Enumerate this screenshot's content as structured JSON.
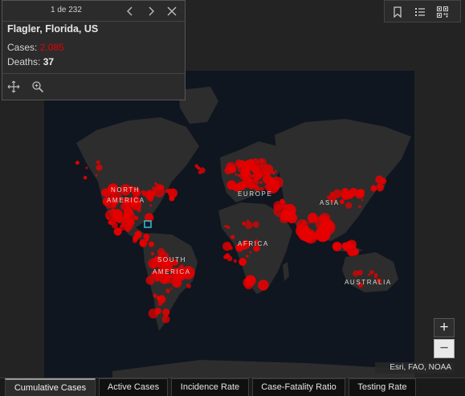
{
  "popup": {
    "counter": "1 de 232",
    "title": "Flagler, Florida, US",
    "cases_label": "Cases: ",
    "cases_value": "2.085",
    "deaths_label": "Deaths: ",
    "deaths_value": "37",
    "icons": [
      "previous-icon",
      "next-icon",
      "close-icon",
      "pan-to-icon",
      "zoom-to-icon"
    ]
  },
  "tools": {
    "icons": [
      "bookmark-icon",
      "list-icon",
      "qr-code-icon"
    ]
  },
  "map": {
    "labels": {
      "north_america": [
        "NORTH",
        "AMERICA"
      ],
      "south_america": [
        "SOUTH",
        "AMERICA"
      ],
      "europe": "EUROPE",
      "asia": "ASIA",
      "africa": "AFRICA",
      "australia": "AUSTRALIA"
    },
    "attribution": "Esri, FAO, NOAA",
    "colors": {
      "ocean": "#0f1620",
      "land": "#2e2e2e",
      "bubble": "#e60000",
      "highlight": "#2bbcd4",
      "background": "#232323"
    }
  },
  "zoom": {
    "in_label": "+",
    "out_label": "−"
  },
  "tabs": [
    "Cumulative Cases",
    "Active Cases",
    "Incidence Rate",
    "Case-Fatality Ratio",
    "Testing Rate"
  ],
  "active_tab": "Cumulative Cases"
}
